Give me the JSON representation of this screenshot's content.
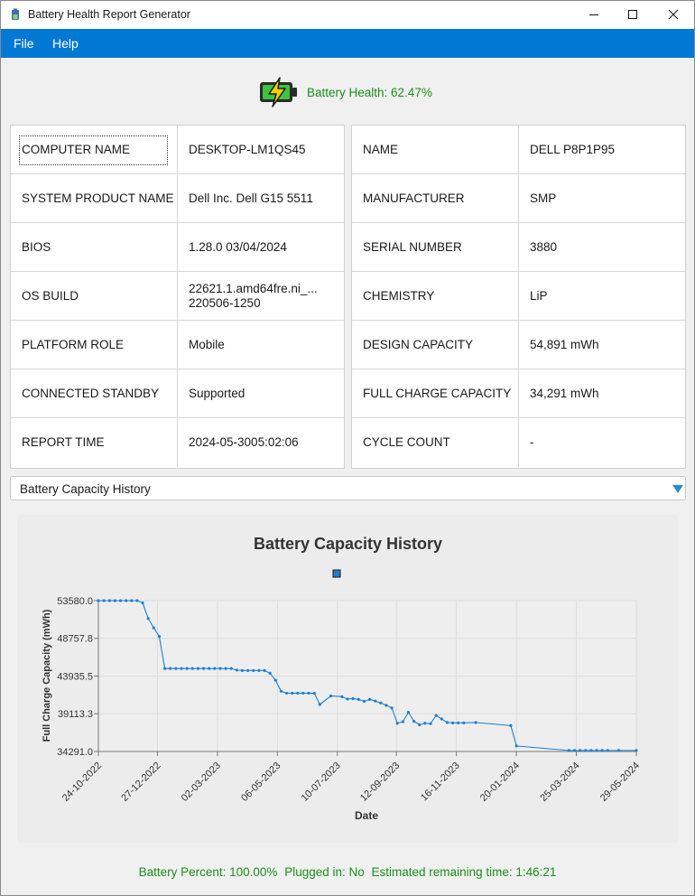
{
  "window": {
    "title": "Battery Health Report Generator"
  },
  "menu": {
    "file": "File",
    "help": "Help"
  },
  "health": {
    "text": "Battery Health: 62.47%"
  },
  "system_info": [
    {
      "key": "COMPUTER NAME",
      "value": "DESKTOP-LM1QS45"
    },
    {
      "key": "SYSTEM PRODUCT NAME",
      "value": "Dell Inc. Dell G15 5511"
    },
    {
      "key": "BIOS",
      "value": "1.28.0 03/04/2024"
    },
    {
      "key": "OS BUILD",
      "value": "22621.1.amd64fre.ni_... 220506-1250"
    },
    {
      "key": "PLATFORM ROLE",
      "value": "Mobile"
    },
    {
      "key": "CONNECTED STANDBY",
      "value": "Supported"
    },
    {
      "key": "REPORT TIME",
      "value": "2024-05-3005:02:06"
    }
  ],
  "battery_info": [
    {
      "key": "NAME",
      "value": "DELL P8P1P95"
    },
    {
      "key": "MANUFACTURER",
      "value": "SMP"
    },
    {
      "key": "SERIAL NUMBER",
      "value": "3880"
    },
    {
      "key": "CHEMISTRY",
      "value": "LiP"
    },
    {
      "key": "DESIGN CAPACITY",
      "value": "54,891 mWh"
    },
    {
      "key": "FULL CHARGE CAPACITY",
      "value": "34,291 mWh"
    },
    {
      "key": "CYCLE COUNT",
      "value": "-"
    }
  ],
  "report_selector": {
    "selected": "Battery Capacity History"
  },
  "status": {
    "percent": "Battery Percent: 100.00%",
    "plugged": "Plugged in: No",
    "remaining": "Estimated remaining time: 1:46:21"
  },
  "colors": {
    "accent": "#0078d4",
    "line": "#1f7fd0",
    "status_green": "#1a8f1a"
  },
  "chart_data": {
    "type": "line",
    "title": "Battery Capacity History",
    "xlabel": "Date",
    "ylabel": "Full Charge Capacity (mWh)",
    "grid": true,
    "legend": "top-center",
    "xlim": [
      "2022-10-24",
      "2024-05-29"
    ],
    "ylim": [
      34291.0,
      53580.0
    ],
    "x_ticks": [
      "24-10-2022",
      "27-12-2022",
      "02-03-2023",
      "06-05-2023",
      "10-07-2023",
      "12-09-2023",
      "16-11-2023",
      "20-01-2024",
      "25-03-2024",
      "29-05-2024"
    ],
    "y_ticks": [
      "34291.0",
      "39113.3",
      "43935.5",
      "48757.8",
      "53580.0"
    ],
    "series": [
      {
        "name": "",
        "x": [
          "2022-10-24",
          "2022-10-30",
          "2022-11-05",
          "2022-11-11",
          "2022-11-17",
          "2022-11-23",
          "2022-11-29",
          "2022-12-05",
          "2022-12-11",
          "2022-12-17",
          "2022-12-23",
          "2022-12-29",
          "2023-01-04",
          "2023-01-10",
          "2023-01-16",
          "2023-01-22",
          "2023-01-28",
          "2023-02-03",
          "2023-02-09",
          "2023-02-15",
          "2023-02-21",
          "2023-02-27",
          "2023-03-05",
          "2023-03-11",
          "2023-03-17",
          "2023-03-23",
          "2023-03-29",
          "2023-04-04",
          "2023-04-10",
          "2023-04-16",
          "2023-04-22",
          "2023-04-28",
          "2023-05-04",
          "2023-05-10",
          "2023-05-16",
          "2023-05-22",
          "2023-05-28",
          "2023-06-03",
          "2023-06-09",
          "2023-06-15",
          "2023-06-21",
          "2023-07-03",
          "2023-07-15",
          "2023-07-21",
          "2023-07-27",
          "2023-08-02",
          "2023-08-08",
          "2023-08-14",
          "2023-08-20",
          "2023-08-26",
          "2023-09-01",
          "2023-09-07",
          "2023-09-13",
          "2023-09-19",
          "2023-09-25",
          "2023-10-01",
          "2023-10-07",
          "2023-10-13",
          "2023-10-19",
          "2023-10-25",
          "2023-10-31",
          "2023-11-06",
          "2023-11-12",
          "2023-11-18",
          "2023-11-24",
          "2023-12-07",
          "2024-01-14",
          "2024-01-20",
          "2024-03-17",
          "2024-03-23",
          "2024-03-29",
          "2024-04-04",
          "2024-04-10",
          "2024-04-16",
          "2024-04-22",
          "2024-04-28",
          "2024-05-10",
          "2024-05-29"
        ],
        "values": [
          53580,
          53580,
          53580,
          53580,
          53580,
          53580,
          53580,
          53580,
          53300,
          51300,
          50100,
          49000,
          44900,
          44900,
          44900,
          44900,
          44900,
          44900,
          44900,
          44900,
          44900,
          44900,
          44900,
          44900,
          44900,
          44700,
          44650,
          44650,
          44650,
          44650,
          44650,
          44300,
          43400,
          42000,
          41750,
          41750,
          41750,
          41750,
          41750,
          41750,
          40300,
          41400,
          41300,
          41000,
          41050,
          40950,
          40700,
          40950,
          40750,
          40500,
          40200,
          39850,
          37900,
          38100,
          39300,
          38150,
          37700,
          37900,
          37850,
          38900,
          38450,
          38000,
          37950,
          37950,
          37950,
          38000,
          37600,
          35000,
          34420,
          34420,
          34420,
          34420,
          34420,
          34420,
          34420,
          34420,
          34420,
          34420
        ]
      }
    ]
  }
}
